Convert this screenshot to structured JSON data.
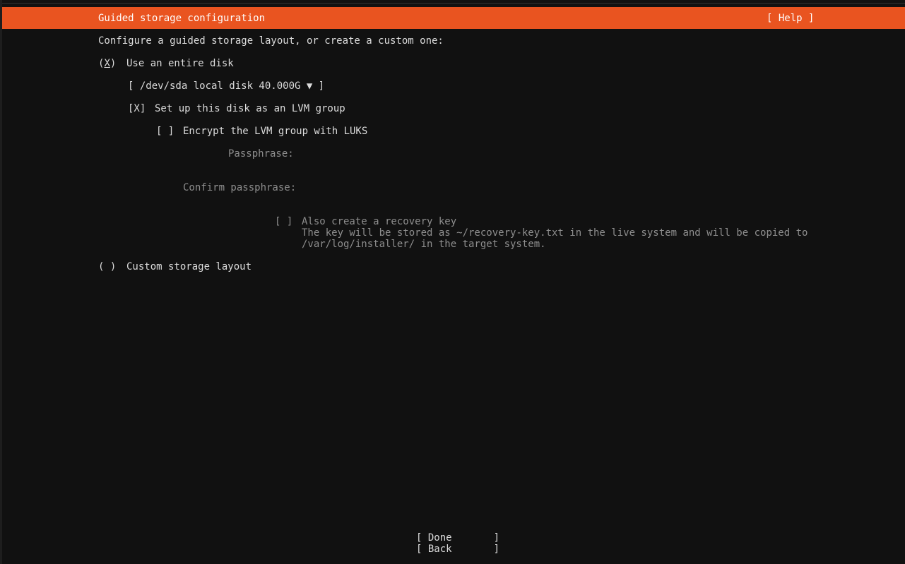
{
  "header": {
    "title": "Guided storage configuration",
    "help_label": "[ Help ]"
  },
  "intro": "Configure a guided storage layout, or create a custom one:",
  "use_entire_disk": {
    "radio_open": "(",
    "radio_mark": "X",
    "radio_close": ")",
    "label": "Use an entire disk"
  },
  "disk_select": {
    "value": "[ /dev/sda local disk 40.000G ▼ ]"
  },
  "lvm": {
    "checkbox": "[X]",
    "label": "Set up this disk as an LVM group"
  },
  "encrypt": {
    "checkbox": "[ ]",
    "label": "Encrypt the LVM group with LUKS"
  },
  "passphrase": {
    "label": "Passphrase:",
    "value": ""
  },
  "confirm_passphrase": {
    "label": "Confirm passphrase:",
    "value": ""
  },
  "recovery_key": {
    "checkbox": "[ ]",
    "label": "Also create a recovery key",
    "description_line1": "The key will be stored as ~/recovery-key.txt in the live system and will be copied to",
    "description_line2": "/var/log/installer/ in the target system."
  },
  "custom_layout": {
    "radio": "( )",
    "label": "Custom storage layout"
  },
  "buttons": {
    "done": "[ Done       ]",
    "back": "[ Back       ]"
  },
  "colors": {
    "accent": "#e95420",
    "background": "#111111",
    "text": "#dcdcdc",
    "disabled_text": "#8e8e8e"
  }
}
